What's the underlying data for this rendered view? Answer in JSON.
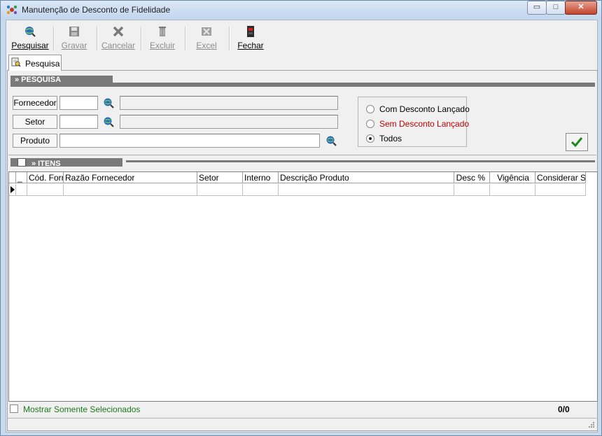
{
  "window": {
    "title": "Manutenção de Desconto de Fidelidade"
  },
  "caption_buttons": {
    "minimize": "▭",
    "maximize": "□",
    "close": "✕"
  },
  "toolbar": [
    {
      "label": "Pesquisar",
      "icon": "search-globe-icon",
      "enabled": true
    },
    {
      "label": "Gravar",
      "icon": "floppy-disk-icon",
      "enabled": false
    },
    {
      "label": "Cancelar",
      "icon": "cancel-x-icon",
      "enabled": false
    },
    {
      "label": "Excluir",
      "icon": "delete-icon",
      "enabled": false
    },
    {
      "label": "Excel",
      "icon": "excel-icon",
      "enabled": false
    },
    {
      "label": "Fechar",
      "icon": "exit-door-icon",
      "enabled": true
    }
  ],
  "tabs": [
    {
      "label": "Pesquisa",
      "active": true
    }
  ],
  "search_section": {
    "header": "» PESQUISA",
    "fields": [
      {
        "label": "Fornecedor",
        "code": "",
        "description": ""
      },
      {
        "label": "Setor",
        "code": "",
        "description": ""
      },
      {
        "label": "Produto",
        "value": ""
      }
    ],
    "filter_options": [
      {
        "label": "Com Desconto Lançado",
        "selected": false,
        "color": "#000000"
      },
      {
        "label": "Sem Desconto Lançado",
        "selected": false,
        "color": "#c00000"
      },
      {
        "label": "Todos",
        "selected": true,
        "color": "#000000"
      }
    ]
  },
  "items_section": {
    "header": "» ITENS",
    "columns": [
      "_",
      "Cód. Forn",
      "Razão Fornecedor",
      "Setor",
      "Interno",
      "Descrição Produto",
      "Desc %",
      "Vigência",
      "Considerar ST"
    ]
  },
  "footer": {
    "show_selected_label": "Mostrar Somente Selecionados",
    "count": "0/0"
  },
  "colors": {
    "accent_green": "#1a7a1a",
    "header_gray": "#7a7a7a",
    "warning_red": "#c00000"
  }
}
